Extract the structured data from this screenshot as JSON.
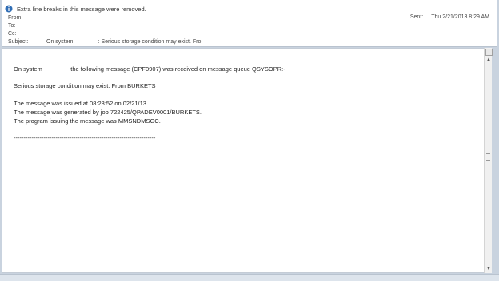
{
  "infobar": {
    "text": "Extra line breaks in this message were removed."
  },
  "header": {
    "from_label": "From:",
    "to_label": "To:",
    "cc_label": "Cc:",
    "subject_label": "Subject:",
    "subject_value": "On system                : Serious storage condition may exist. Fro",
    "sent_label": "Sent:",
    "sent_value": "Thu 2/21/2013 8:29 AM"
  },
  "message": {
    "lines": [
      "On system                 the following message (CPF0907) was received on message queue QSYSOPR:-",
      "Serious storage condition may exist. From BURKETS",
      "The message was issued at 08:28:52 on 02/21/13.",
      "The message was generated by job 722425/QPADEV0001/BURKETS.",
      "The program issuing the message was MMSNDMSGC.",
      "-----------------------------------------------------------------------"
    ]
  }
}
